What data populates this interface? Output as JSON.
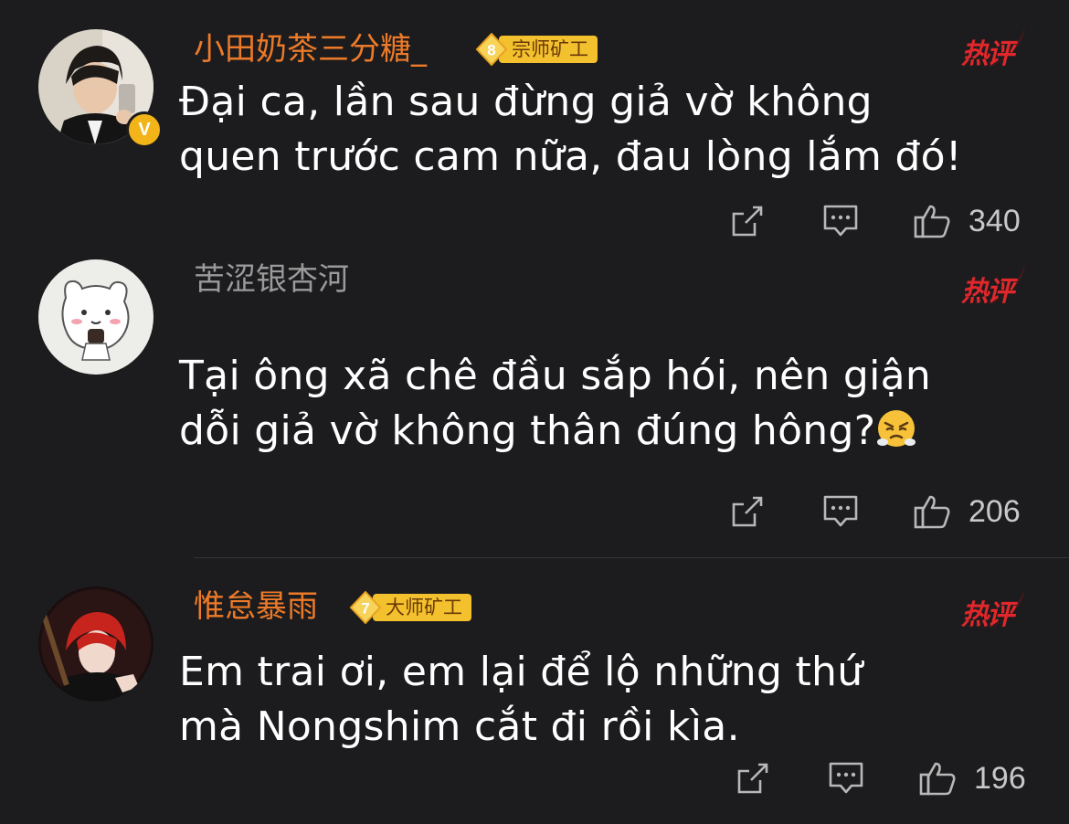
{
  "comments": [
    {
      "username": "小田奶茶三分糖_",
      "username_color": "#ec7a29",
      "verified_badge": "V",
      "level": "8",
      "level_title": "宗师矿工",
      "hot_label": "热评",
      "content_line1": "Đại ca, lần sau đừng giả vờ không",
      "content_line2": "quen trước cam nữa, đau lòng lắm đó!",
      "likes": "340"
    },
    {
      "username": "苦涩银杏河",
      "username_color": "#9a9a9a",
      "hot_label": "热评",
      "content_line1": "Tại ông xã chê đầu sắp hói, nên giận",
      "content_line2": "dỗi giả vờ không thân đúng hông?",
      "emoji": "huffing-face-emoji",
      "likes": "206"
    },
    {
      "username": "惟怠暴雨",
      "username_color": "#ec7a29",
      "level": "7",
      "level_title": "大师矿工",
      "hot_label": "热评",
      "content_line1": "Em trai ơi, em lại để lộ những thứ",
      "content_line2": "mà Nongshim cắt đi rồi kìa.",
      "likes": "196"
    }
  ],
  "icons": {
    "share": "share-icon",
    "reply": "comment-icon",
    "like": "thumbs-up-icon"
  },
  "colors": {
    "background": "#1c1c1e",
    "accent_orange": "#ec7a29",
    "hot_red": "#e0272b",
    "badge_gold": "#f3c02e"
  }
}
